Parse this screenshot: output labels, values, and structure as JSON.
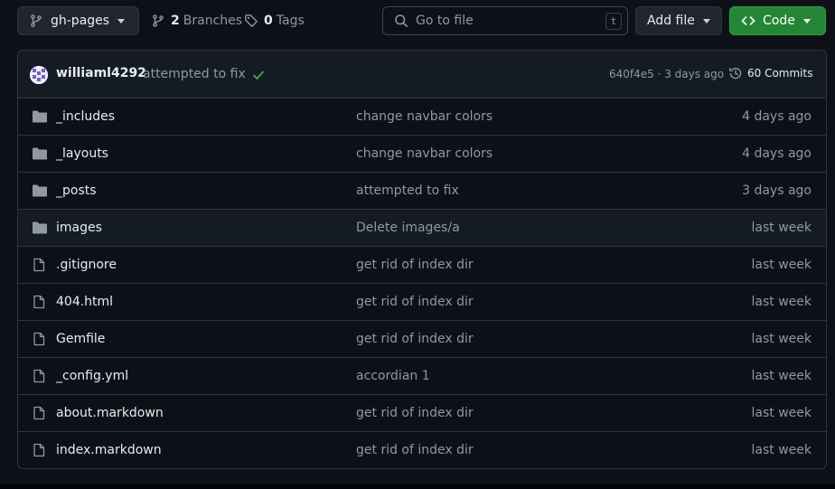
{
  "toolbar": {
    "branch_name": "gh-pages",
    "branches_count": "2",
    "branches_label": "Branches",
    "tags_count": "0",
    "tags_label": "Tags",
    "search_placeholder": "Go to file",
    "search_shortcut": "t",
    "add_file_label": "Add file",
    "code_label": "Code"
  },
  "latest_commit": {
    "author": "williaml4292",
    "message": "attempted to fix",
    "status": "success",
    "sha_and_time": "640f4e5 · 3 days ago",
    "commits_label": "60 Commits"
  },
  "colors": {
    "background": "#0d1117",
    "code_button": "#238636",
    "success_check": "#3fb950",
    "folder_icon": "#9198a1"
  },
  "files": [
    {
      "type": "folder",
      "icon": "folder-icon",
      "name": "_includes",
      "message": "change navbar colors",
      "date": "4 days ago"
    },
    {
      "type": "folder",
      "icon": "folder-icon",
      "name": "_layouts",
      "message": "change navbar colors",
      "date": "4 days ago"
    },
    {
      "type": "folder",
      "icon": "folder-icon",
      "name": "_posts",
      "message": "attempted to fix",
      "date": "3 days ago"
    },
    {
      "type": "folder",
      "icon": "folder-icon",
      "name": "images",
      "message": "Delete images/a",
      "date": "last week"
    },
    {
      "type": "file",
      "icon": "file-icon",
      "name": ".gitignore",
      "message": "get rid of index dir",
      "date": "last week"
    },
    {
      "type": "file",
      "icon": "file-icon",
      "name": "404.html",
      "message": "get rid of index dir",
      "date": "last week"
    },
    {
      "type": "file",
      "icon": "file-icon",
      "name": "Gemfile",
      "message": "get rid of index dir",
      "date": "last week"
    },
    {
      "type": "file",
      "icon": "file-icon",
      "name": "_config.yml",
      "message": "accordian 1",
      "date": "last week"
    },
    {
      "type": "file",
      "icon": "file-icon",
      "name": "about.markdown",
      "message": "get rid of index dir",
      "date": "last week"
    },
    {
      "type": "file",
      "icon": "file-icon",
      "name": "index.markdown",
      "message": "get rid of index dir",
      "date": "last week"
    }
  ]
}
